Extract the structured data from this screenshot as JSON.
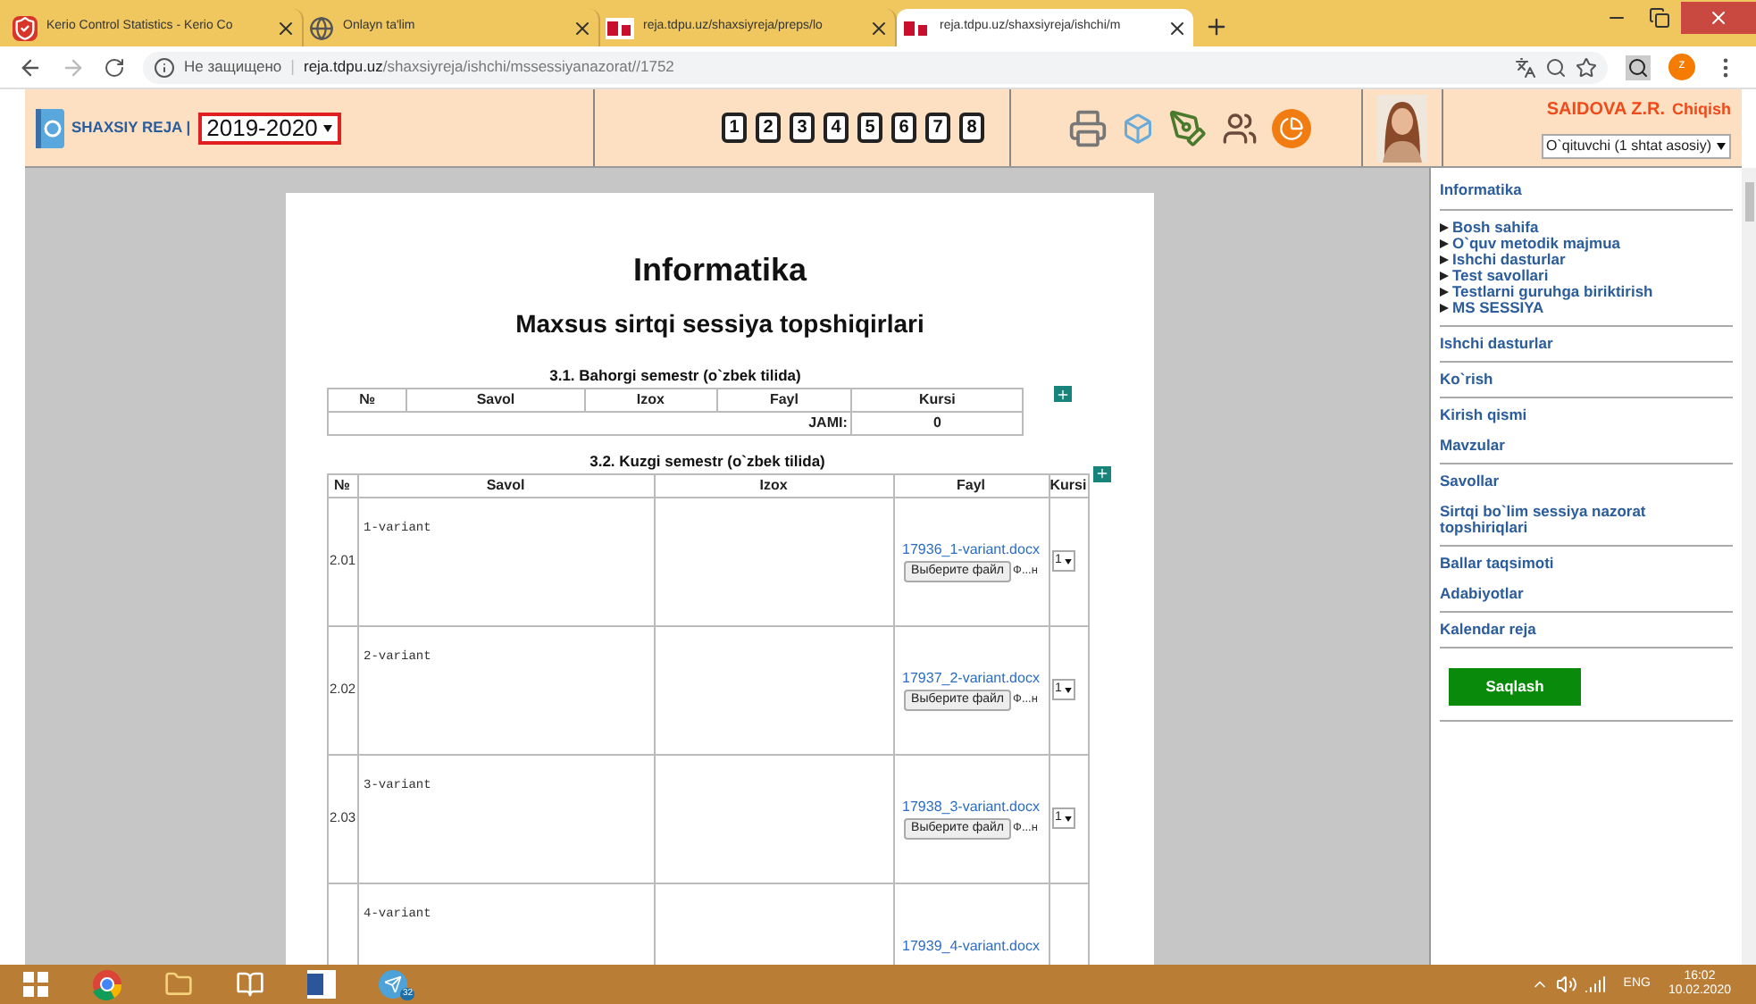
{
  "browser": {
    "tabs": [
      {
        "title": "Kerio Control Statistics - Kerio Co",
        "selected": false
      },
      {
        "title": "Onlayn ta'lim",
        "selected": false
      },
      {
        "title": "reja.tdpu.uz/shaxsiyreja/preps/lo",
        "selected": false
      },
      {
        "title": "reja.tdpu.uz/shaxsiyreja/ishchi/m",
        "selected": true
      }
    ],
    "security": "Не защищено",
    "separator": "|",
    "url_host": "reja.tdpu.uz",
    "url_path": "/shaxsiyreja/ishchi/mssessiyanazorat//1752",
    "profile_initial": "z"
  },
  "header": {
    "brand": "SHAXSIY REJA |",
    "year": "2019-2020",
    "page_buttons": [
      "1",
      "2",
      "3",
      "4",
      "5",
      "6",
      "7",
      "8"
    ],
    "user": "SAIDOVA Z.R.",
    "logout": "Chiqish",
    "role": "O`qituvchi (1 shtat asosiy)"
  },
  "document": {
    "title": "Informatika",
    "subtitle": "Maxsus sirtqi sessiya topshiqirlari",
    "spring": {
      "caption": "3.1. Bahorgi semestr (o`zbek tilida)",
      "columns": [
        "№",
        "Savol",
        "Izox",
        "Fayl",
        "Kursi"
      ],
      "total_label": "JAMI:",
      "total": "0"
    },
    "autumn": {
      "caption": "3.2. Kuzgi semestr (o`zbek tilida)",
      "columns": [
        "№",
        "Savol",
        "Izox",
        "Fayl",
        "Kursi"
      ],
      "rows": [
        {
          "number": "2.01",
          "savol": "1-variant",
          "file": "17936_1-variant.docx",
          "choose": "Выберите файл",
          "no_file": "Ф...н",
          "kursi": "1"
        },
        {
          "number": "2.02",
          "savol": "2-variant",
          "file": "17937_2-variant.docx",
          "choose": "Выберите файл",
          "no_file": "Ф...н",
          "kursi": "1"
        },
        {
          "number": "2.03",
          "savol": "3-variant",
          "file": "17938_3-variant.docx",
          "choose": "Выберите файл",
          "no_file": "Ф...н",
          "kursi": "1"
        },
        {
          "savol": "4-variant",
          "file": "17939_4-variant.docx"
        }
      ]
    }
  },
  "sidebar": {
    "sections": [
      {
        "kind": "title",
        "items": [
          "Informatika"
        ]
      },
      {
        "kind": "links",
        "items": [
          "Bosh sahifa",
          "O`quv metodik majmua",
          "Ishchi dasturlar",
          "Test savollari",
          "Testlarni guruhga biriktirish",
          "MS SESSIYA"
        ]
      },
      {
        "kind": "menu",
        "items": [
          "Ishchi dasturlar"
        ]
      },
      {
        "kind": "menu",
        "items": [
          "Ko`rish"
        ]
      },
      {
        "kind": "menu",
        "items": [
          "Kirish qismi",
          "Mavzular"
        ]
      },
      {
        "kind": "menu",
        "items": [
          "Savollar",
          "Sirtqi bo`lim sessiya nazorat topshiriqlari"
        ]
      },
      {
        "kind": "menu",
        "items": [
          "Ballar taqsimoti",
          "Adabiyotlar"
        ]
      },
      {
        "kind": "menu",
        "items": [
          "Kalendar reja"
        ]
      }
    ],
    "save": "Saqlash"
  },
  "taskbar": {
    "badge": "32",
    "lang": "ENG",
    "time": "16:02",
    "date": "10.02.2020"
  }
}
